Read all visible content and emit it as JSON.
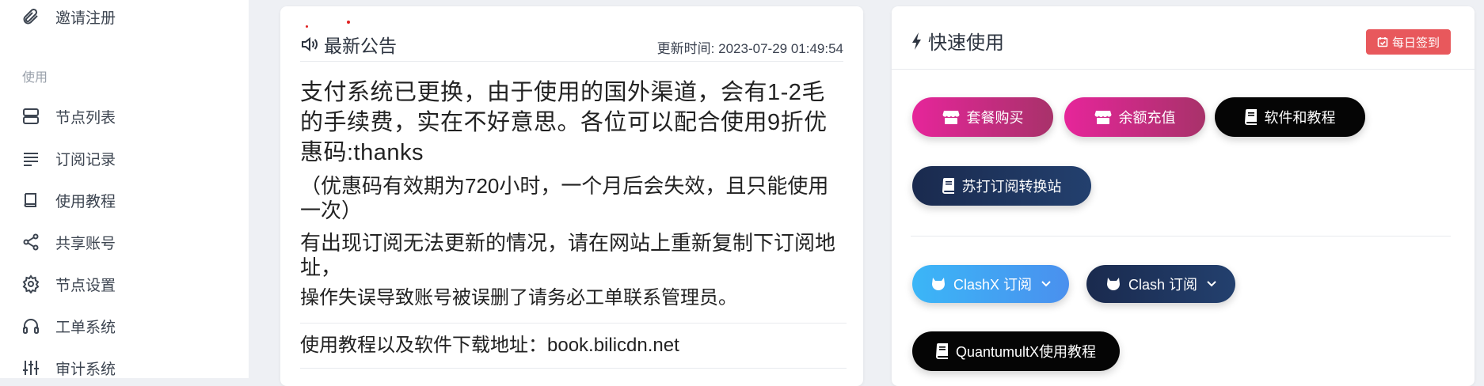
{
  "sidebar": {
    "items_top": [
      {
        "label": "邀请注册",
        "icon": "paperclip-icon"
      }
    ],
    "section_label": "使用",
    "items": [
      {
        "label": "节点列表",
        "icon": "server-icon"
      },
      {
        "label": "订阅记录",
        "icon": "lines-icon"
      },
      {
        "label": "使用教程",
        "icon": "book-icon"
      },
      {
        "label": "共享账号",
        "icon": "share-icon"
      },
      {
        "label": "节点设置",
        "icon": "gear-icon"
      },
      {
        "label": "工单系统",
        "icon": "headphones-icon"
      },
      {
        "label": "审计系统",
        "icon": "sliders-icon"
      }
    ]
  },
  "notice": {
    "title": "最新公告",
    "updated_label": "更新时间:",
    "updated_time": "2023-07-29 01:49:54",
    "paragraphs": [
      "支付系统已更换，由于使用的国外渠道，会有1-2毛的手续费，实在不好意思。各位可以配合使用9折优惠码:thanks",
      "（优惠码有效期为720小时，一个月后会失效，且只能使用一次）",
      "有出现订阅无法更新的情况，请在网站上重新复制下订阅地址，",
      "操作失误导致账号被误删了请务必工单联系管理员。"
    ],
    "tutorial_line": "使用教程以及软件下载地址：book.bilicdn.net"
  },
  "quick": {
    "title": "快速使用",
    "checkin_label": "每日签到",
    "buttons": {
      "buy_plan": "套餐购买",
      "recharge": "余额充值",
      "software": "软件和教程",
      "sub_convert": "苏打订阅转换站",
      "clashx": "ClashX 订阅",
      "clash": "Clash 订阅",
      "quantumultx": "QuantumultX使用教程"
    }
  },
  "colors": {
    "pink_start": "#e6259a",
    "pink_end": "#a8326a",
    "navy": "#1a2a4e",
    "sky": "#3bb6f7",
    "checkin": "#e8585c"
  }
}
